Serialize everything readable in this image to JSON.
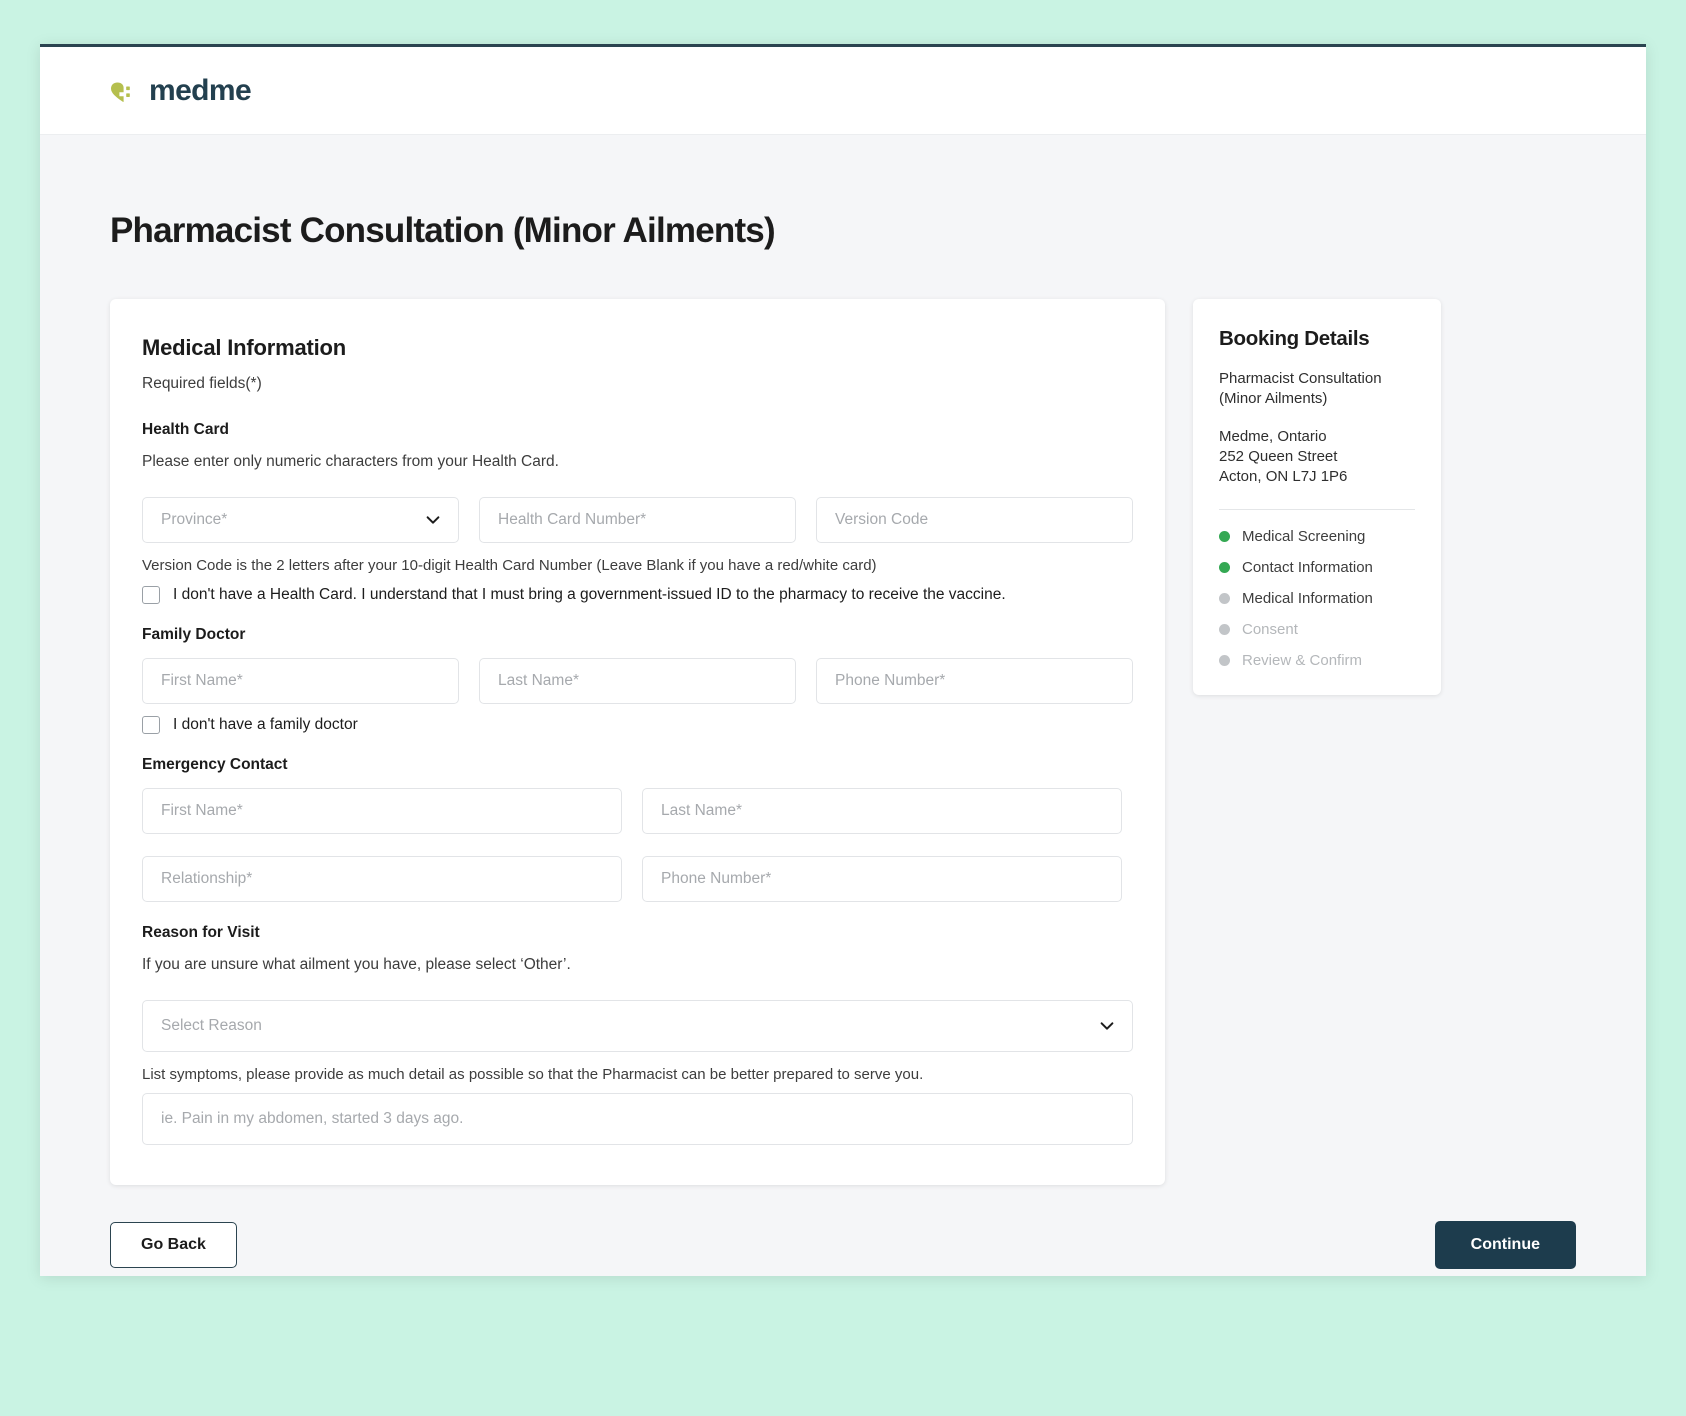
{
  "brand": {
    "name": "medme",
    "logo_color": "#b5bf4e",
    "text_color": "#23404f"
  },
  "page": {
    "title": "Pharmacist Consultation (Minor Ailments)"
  },
  "form": {
    "section_title": "Medical Information",
    "required_note": "Required fields(*)",
    "health_card": {
      "label": "Health Card",
      "help": "Please enter only numeric characters from your Health Card.",
      "province_placeholder": "Province*",
      "number_placeholder": "Health Card Number*",
      "version_placeholder": "Version Code",
      "version_hint": "Version Code is the 2 letters after your 10-digit Health Card Number (Leave Blank if you have a red/white card)",
      "no_card_checkbox": "I don't have a Health Card. I understand that I must bring a government-issued ID to the pharmacy to receive the vaccine."
    },
    "family_doctor": {
      "label": "Family Doctor",
      "first_name_placeholder": "First Name*",
      "last_name_placeholder": "Last Name*",
      "phone_placeholder": "Phone Number*",
      "no_doctor_checkbox": "I don't have a family doctor"
    },
    "emergency_contact": {
      "label": "Emergency Contact",
      "first_name_placeholder": "First Name*",
      "last_name_placeholder": "Last Name*",
      "relationship_placeholder": "Relationship*",
      "phone_placeholder": "Phone Number*"
    },
    "reason_for_visit": {
      "label": "Reason for Visit",
      "help": "If you are unsure what ailment you have, please select ‘Other’.",
      "select_placeholder": "Select Reason",
      "symptoms_help": "List symptoms, please provide as much detail as possible so that the Pharmacist can be better prepared to serve you.",
      "symptoms_placeholder": "ie. Pain in my abdomen, started 3 days ago."
    }
  },
  "booking": {
    "title": "Booking Details",
    "service_line1": "Pharmacist Consultation",
    "service_line2": "(Minor Ailments)",
    "address_line1": "Medme, Ontario",
    "address_line2": "252 Queen Street",
    "address_line3": "Acton, ON L7J 1P6",
    "done_color": "#34a853",
    "todo_color": "#c2c5c8",
    "steps": [
      {
        "label": "Medical Screening",
        "state": "done"
      },
      {
        "label": "Contact Information",
        "state": "done"
      },
      {
        "label": "Medical Information",
        "state": "current"
      },
      {
        "label": "Consent",
        "state": "todo"
      },
      {
        "label": "Review & Confirm",
        "state": "todo"
      }
    ]
  },
  "footer": {
    "back_label": "Go Back",
    "continue_label": "Continue"
  }
}
